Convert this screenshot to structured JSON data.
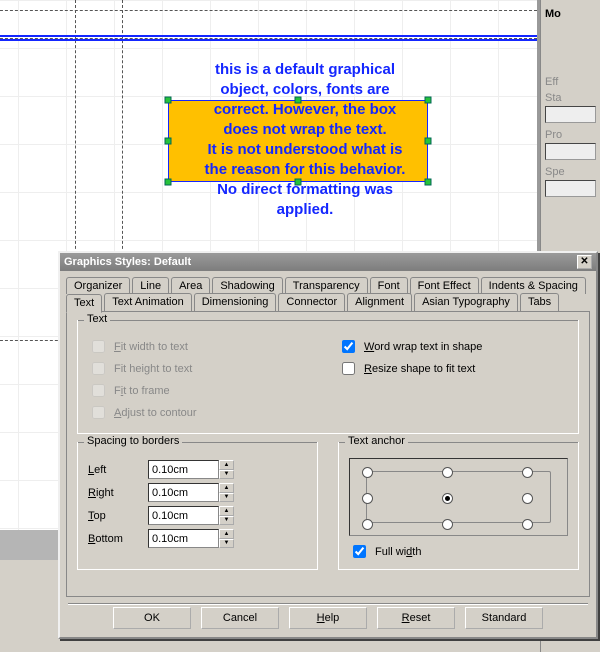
{
  "canvas": {
    "text_lines": [
      "this is a default graphical",
      "object, colors, fonts are",
      "correct. However, the box",
      "does not wrap the text.",
      "It is not understood what is",
      "the reason for this behavior.",
      "No direct formatting was",
      "applied."
    ]
  },
  "right_panel": {
    "mo_label": "Mo",
    "eff_label": "Eff",
    "sta_label": "Sta",
    "pro_label": "Pro",
    "spe_label": "Spe"
  },
  "dialog": {
    "title": "Graphics Styles: Default",
    "tabs_row1": [
      "Organizer",
      "Line",
      "Area",
      "Shadowing",
      "Transparency",
      "Font",
      "Font Effect",
      "Indents & Spacing"
    ],
    "tabs_row2": [
      "Text",
      "Text Animation",
      "Dimensioning",
      "Connector",
      "Alignment",
      "Asian Typography",
      "Tabs"
    ],
    "active_tab": "Text",
    "text_group": {
      "legend": "Text",
      "fit_width": "Fit width to text",
      "fit_height": "Fit height to text",
      "fit_frame": "Fit to frame",
      "adjust_contour": "Adjust to contour",
      "word_wrap": "Word wrap text in shape",
      "resize_shape": "Resize shape to fit text",
      "word_wrap_checked": true,
      "resize_checked": false
    },
    "spacing_group": {
      "legend": "Spacing to borders",
      "left_label": "Left",
      "right_label": "Right",
      "top_label": "Top",
      "bottom_label": "Bottom",
      "left": "0.10cm",
      "right": "0.10cm",
      "top": "0.10cm",
      "bottom": "0.10cm"
    },
    "anchor_group": {
      "legend": "Text anchor",
      "full_width": "Full width",
      "full_width_checked": true
    },
    "buttons": {
      "ok": "OK",
      "cancel": "Cancel",
      "help": "Help",
      "reset": "Reset",
      "standard": "Standard"
    }
  }
}
